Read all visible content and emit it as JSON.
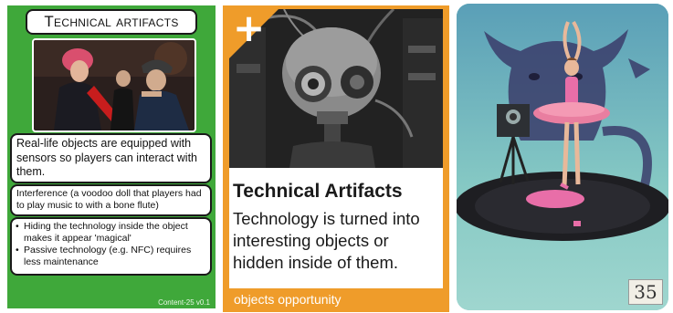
{
  "technical_card": {
    "title": "Technical artifacts",
    "description": "Real-life objects are equipped with sensors so players can interact with them.",
    "example": "Interference (a voodoo doll that players had to play music to with a bone flute)",
    "notes": [
      "Hiding the technology inside the object makes it appear 'magical'",
      "Passive technology (e.g. NFC) requires less maintenance"
    ],
    "footer": "Content-25 v0.1",
    "background_color": "#3fa83a"
  },
  "opportunity_card": {
    "plus_symbol": "+",
    "title": "Technical Artifacts",
    "description": "Technology is turned into interesting objects or hidden inside of them.",
    "footer": "objects opportunity",
    "background_color": "#ef9c2a"
  },
  "tarot_card": {
    "number": "35",
    "background_color": "#77bfc2"
  }
}
